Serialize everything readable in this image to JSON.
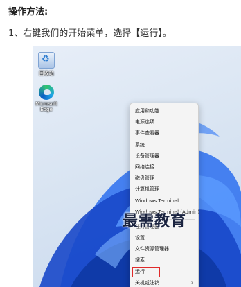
{
  "article": {
    "heading": "操作方法:",
    "instruction": "1、右键我们的开始菜单，选择【运行】。"
  },
  "desktop": {
    "icons": [
      {
        "label": "回收站",
        "icon": "recycle-bin-icon"
      },
      {
        "label": "Microsoft Edge",
        "icon": "edge-icon"
      }
    ]
  },
  "context_menu": {
    "items": [
      {
        "label": "应用和功能"
      },
      {
        "label": "电源选项"
      },
      {
        "label": "事件查看器"
      },
      {
        "label": "系统"
      },
      {
        "label": "设备管理器"
      },
      {
        "label": "网络连接"
      },
      {
        "label": "磁盘管理"
      },
      {
        "label": "计算机管理"
      },
      {
        "label": "Windows Terminal"
      },
      {
        "label": "Windows Terminal (Admin)"
      },
      {
        "label": "任务管理器"
      },
      {
        "label": "设置"
      },
      {
        "label": "文件资源管理器"
      },
      {
        "label": "搜索"
      },
      {
        "label": "运行"
      },
      {
        "label": "关机或注销"
      }
    ],
    "highlight_color": "#e02a2a"
  },
  "watermark": {
    "text": "最需教育"
  },
  "colors": {
    "wallpaper_bloom": "#1f5fe0",
    "menu_background": "#f4f4f4"
  }
}
